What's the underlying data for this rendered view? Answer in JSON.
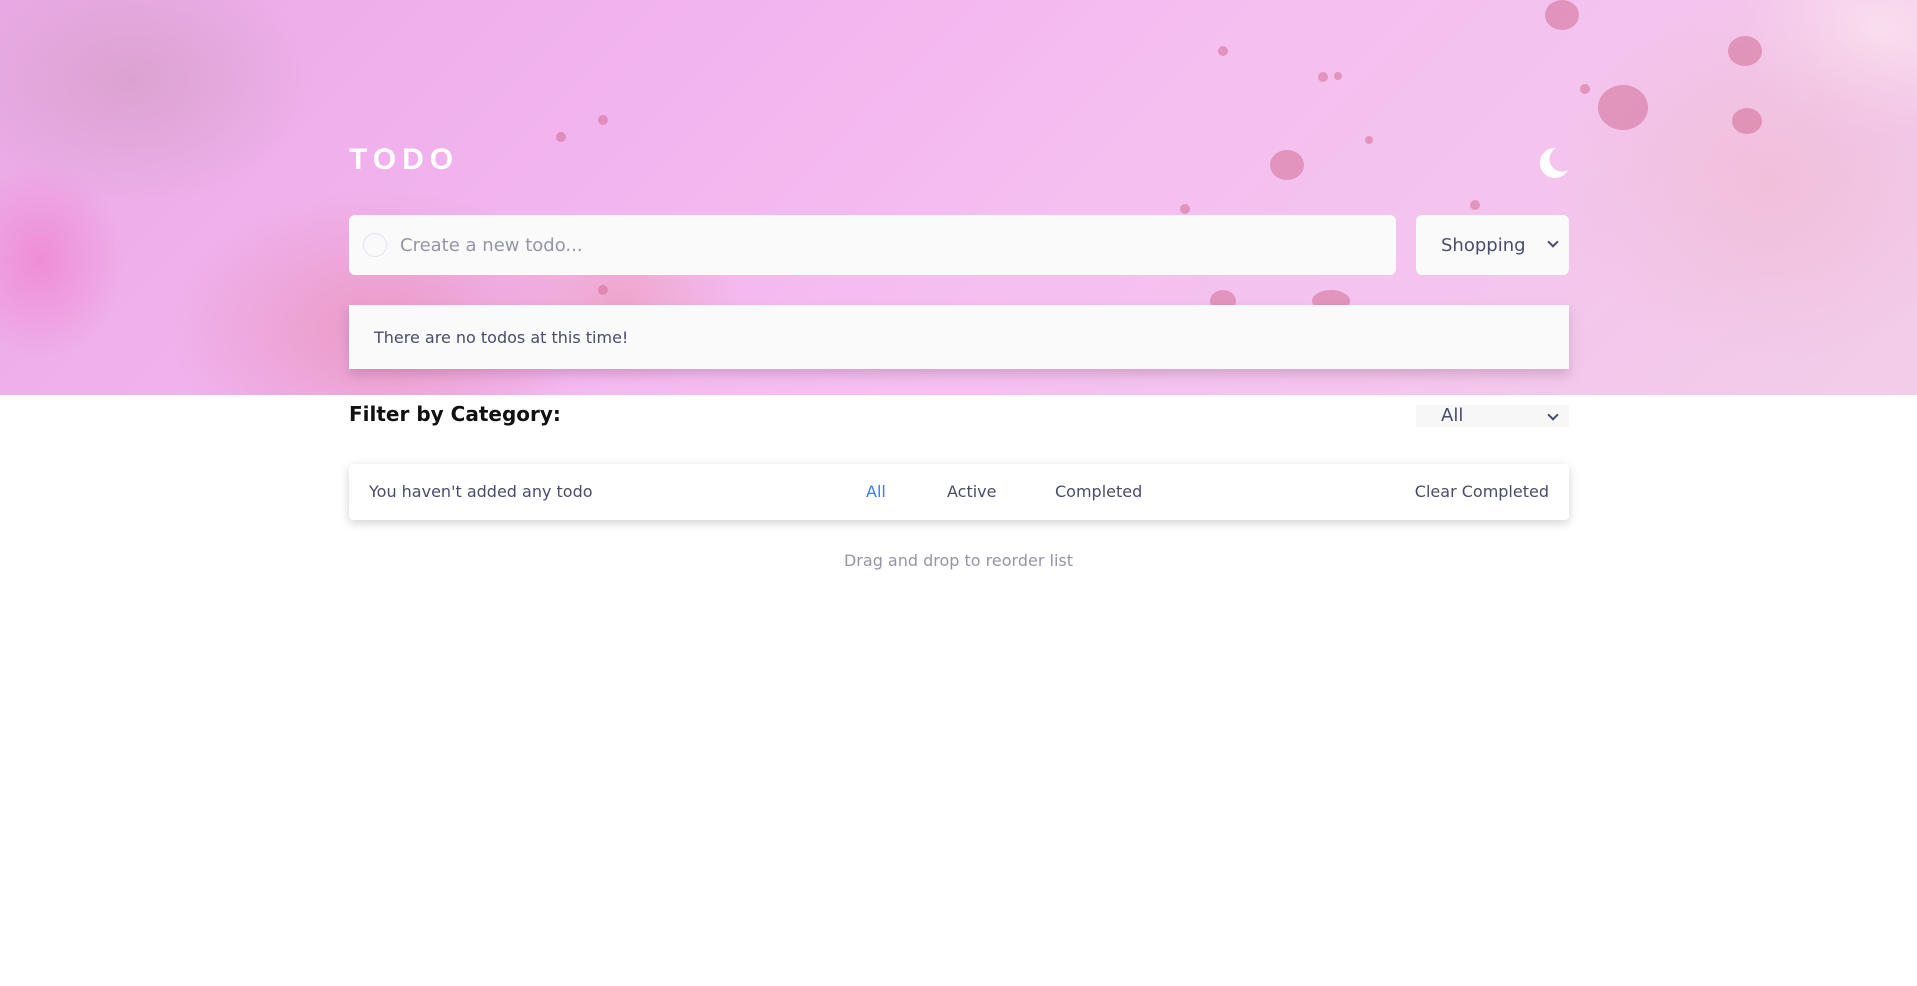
{
  "header": {
    "title": "TODO",
    "theme_toggle_icon": "moon-icon"
  },
  "new_todo": {
    "placeholder": "Create a new todo...",
    "value": "",
    "category_selected": "Shopping"
  },
  "list": {
    "empty_message": "There are no todos at this time!"
  },
  "filter": {
    "label": "Filter by Category:",
    "selected": "All"
  },
  "footer": {
    "count_text": "You haven't added any todo",
    "tabs": [
      "All",
      "Active",
      "Completed"
    ],
    "active_tab": "All",
    "clear_label": "Clear Completed"
  },
  "hint": "Drag and drop to reorder list",
  "colors": {
    "accent": "#3a7cfd",
    "card_bg": "#fafafa",
    "text": "#494c6b",
    "muted": "#9495a5"
  }
}
